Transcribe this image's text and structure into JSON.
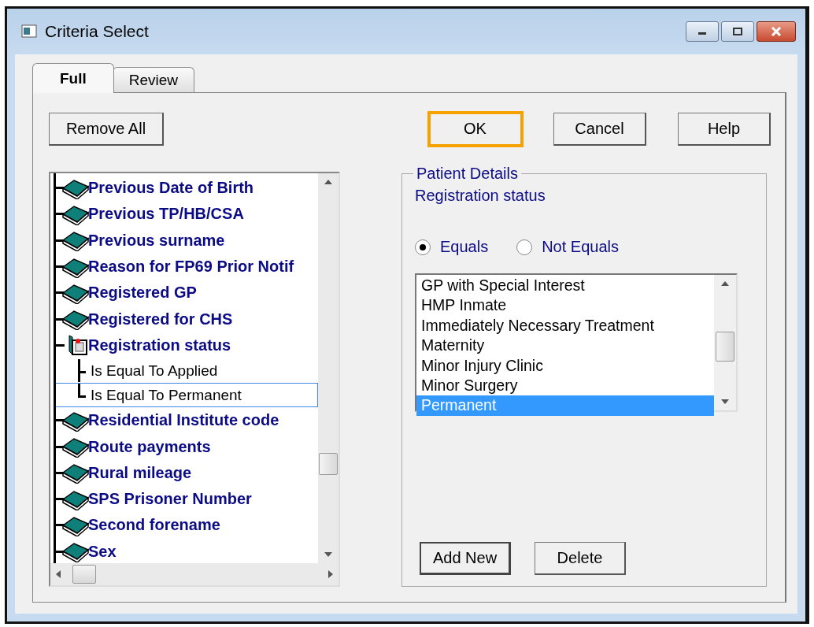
{
  "window": {
    "title": "Criteria Select"
  },
  "tabs": [
    {
      "label": "Full",
      "selected": true
    },
    {
      "label": "Review",
      "selected": false
    }
  ],
  "toolbar": {
    "remove_all": "Remove All",
    "buttons": [
      {
        "label": "OK",
        "focused": true
      },
      {
        "label": "Cancel",
        "focused": false
      },
      {
        "label": "Help",
        "focused": false
      }
    ]
  },
  "tree": {
    "items": [
      {
        "label": "Previous Date of Birth",
        "kind": "field",
        "expanded": false
      },
      {
        "label": "Previous TP/HB/CSA",
        "kind": "field",
        "expanded": false
      },
      {
        "label": "Previous surname",
        "kind": "field",
        "expanded": false
      },
      {
        "label": "Reason for FP69 Prior Notif",
        "kind": "field",
        "expanded": false
      },
      {
        "label": "Registered GP",
        "kind": "field",
        "expanded": false
      },
      {
        "label": "Registered for CHS",
        "kind": "field",
        "expanded": false
      },
      {
        "label": "Registration status",
        "kind": "field",
        "expanded": true,
        "children": [
          {
            "label": "Is Equal To Applied",
            "selected": false
          },
          {
            "label": "Is Equal To Permanent",
            "selected": true
          }
        ]
      },
      {
        "label": "Residential Institute code",
        "kind": "field",
        "expanded": false
      },
      {
        "label": "Route payments",
        "kind": "field",
        "expanded": false
      },
      {
        "label": "Rural mileage",
        "kind": "field",
        "expanded": false
      },
      {
        "label": "SPS Prisoner Number",
        "kind": "field",
        "expanded": false
      },
      {
        "label": "Second forename",
        "kind": "field",
        "expanded": false
      },
      {
        "label": "Sex",
        "kind": "field",
        "expanded": false
      }
    ]
  },
  "details": {
    "group": "Patient Details",
    "field": "Registration status",
    "operators": [
      {
        "label": "Equals",
        "selected": true
      },
      {
        "label": "Not Equals",
        "selected": false
      }
    ],
    "values": [
      {
        "label": "GP with Special Interest",
        "selected": false
      },
      {
        "label": "HMP Inmate",
        "selected": false
      },
      {
        "label": "Immediately Necessary Treatment",
        "selected": false
      },
      {
        "label": "Maternity",
        "selected": false
      },
      {
        "label": "Minor Injury Clinic",
        "selected": false
      },
      {
        "label": "Minor Surgery",
        "selected": false
      },
      {
        "label": "Permanent",
        "selected": true
      }
    ],
    "add_new": "Add New",
    "delete": "Delete"
  }
}
